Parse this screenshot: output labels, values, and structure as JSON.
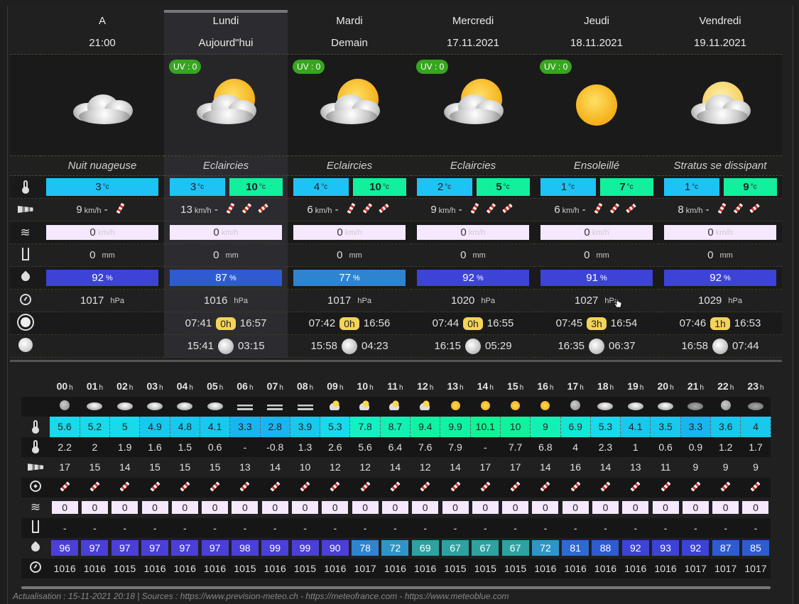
{
  "days": [
    {
      "name": "A",
      "date": "21:00",
      "desc": "Nuit nuageuse",
      "tmin": "3",
      "tmax": null,
      "wind": "9",
      "gust": "0",
      "rain": "0",
      "hum": "92",
      "humColor": "#3c43d6",
      "press": "1017",
      "sunrise": null,
      "daylen": null,
      "sunset": null,
      "moonrise": null,
      "moonset": null,
      "uv": null,
      "icon": "cloud"
    },
    {
      "name": "Lundi",
      "date": "Aujourd\"hui",
      "desc": "Eclaircies",
      "tmin": "3",
      "tmax": "10",
      "wind": "13",
      "gust": "0",
      "rain": "0",
      "hum": "87",
      "humColor": "#2e5bd0",
      "press": "1016",
      "sunrise": "07:41",
      "daylen": "0h",
      "sunset": "16:57",
      "moonrise": "15:41",
      "moonset": "03:15",
      "uv": "UV : 0",
      "icon": "suncloud"
    },
    {
      "name": "Mardi",
      "date": "Demain",
      "desc": "Eclaircies",
      "tmin": "4",
      "tmax": "10",
      "wind": "6",
      "gust": "0",
      "rain": "0",
      "hum": "77",
      "humColor": "#2f84cf",
      "press": "1017",
      "sunrise": "07:42",
      "daylen": "0h",
      "sunset": "16:56",
      "moonrise": "15:58",
      "moonset": "04:23",
      "uv": "UV : 0",
      "icon": "suncloud"
    },
    {
      "name": "Mercredi",
      "date": "17.11.2021",
      "desc": "Eclaircies",
      "tmin": "2",
      "tmax": "5",
      "wind": "9",
      "gust": "0",
      "rain": "0",
      "hum": "92",
      "humColor": "#3c43d6",
      "press": "1020",
      "sunrise": "07:44",
      "daylen": "0h",
      "sunset": "16:55",
      "moonrise": "16:15",
      "moonset": "05:29",
      "uv": "UV : 0",
      "icon": "suncloud"
    },
    {
      "name": "Jeudi",
      "date": "18.11.2021",
      "desc": "Ensoleillé",
      "tmin": "1",
      "tmax": "7",
      "wind": "6",
      "gust": "0",
      "rain": "0",
      "hum": "91",
      "humColor": "#3c43d6",
      "press": "1027",
      "sunrise": "07:45",
      "daylen": "3h",
      "sunset": "16:54",
      "moonrise": "16:35",
      "moonset": "06:37",
      "uv": "UV : 0",
      "icon": "sun"
    },
    {
      "name": "Vendredi",
      "date": "19.11.2021",
      "desc": "Stratus se dissipant",
      "tmin": "1",
      "tmax": "9",
      "wind": "8",
      "gust": "0",
      "rain": "0",
      "hum": "92",
      "humColor": "#3c43d6",
      "press": "1029",
      "sunrise": "07:46",
      "daylen": "1h",
      "sunset": "16:53",
      "moonrise": "16:58",
      "moonset": "07:44",
      "uv": null,
      "icon": "sunbehind"
    }
  ],
  "units": {
    "temp": "°c",
    "wind": "km/h",
    "gust": "km/h",
    "rain": "mm",
    "hum": "%",
    "press": "hPa",
    "wind_sep": "-",
    "hour": "h"
  },
  "hours": [
    "00",
    "01",
    "02",
    "03",
    "04",
    "05",
    "06",
    "07",
    "08",
    "09",
    "10",
    "11",
    "12",
    "13",
    "14",
    "15",
    "16",
    "17",
    "18",
    "19",
    "20",
    "21",
    "22",
    "23"
  ],
  "hourly": {
    "temp": [
      "5.6",
      "5.2",
      "5",
      "4.9",
      "4.8",
      "4.1",
      "3.3",
      "2.8",
      "3.9",
      "5.3",
      "7.8",
      "8.7",
      "9.4",
      "9.9",
      "10.1",
      "10",
      "9",
      "6.9",
      "5.3",
      "4.1",
      "3.5",
      "3.3",
      "3.6",
      "4"
    ],
    "tempColors": [
      "#19d9ea",
      "#19d9ea",
      "#19d9ea",
      "#19c8ec",
      "#19c8ec",
      "#19c8ec",
      "#1ab5ee",
      "#1ab5ee",
      "#19c8ec",
      "#19d9ea",
      "#14f0c4",
      "#14f0b4",
      "#12f2a4",
      "#12f2a4",
      "#12f296",
      "#12f29c",
      "#14f0b4",
      "#14e7d4",
      "#19d9ea",
      "#19c8ec",
      "#19c8ec",
      "#1ab5ee",
      "#19c8ec",
      "#19c8ec"
    ],
    "feels": [
      "2.2",
      "2",
      "1.9",
      "1.6",
      "1.5",
      "0.6",
      "-",
      "-0.8",
      "1.3",
      "2.6",
      "5.6",
      "6.4",
      "7.6",
      "7.9",
      "-",
      "7.7",
      "6.8",
      "4",
      "2.3",
      "1",
      "0.6",
      "0.9",
      "1.2",
      "1.7"
    ],
    "wind": [
      "17",
      "15",
      "14",
      "15",
      "15",
      "15",
      "13",
      "14",
      "10",
      "12",
      "12",
      "14",
      "12",
      "14",
      "17",
      "17",
      "14",
      "16",
      "14",
      "13",
      "11",
      "9",
      "9",
      "9"
    ],
    "gust": [
      "0",
      "0",
      "0",
      "0",
      "0",
      "0",
      "0",
      "0",
      "0",
      "0",
      "0",
      "0",
      "0",
      "0",
      "0",
      "0",
      "0",
      "0",
      "0",
      "0",
      "0",
      "0",
      "0",
      "0"
    ],
    "rain": [
      "-",
      "-",
      "-",
      "-",
      "-",
      "-",
      "-",
      "-",
      "-",
      "-",
      "-",
      "-",
      "-",
      "-",
      "-",
      "-",
      "-",
      "-",
      "-",
      "-",
      "-",
      "-",
      "-",
      "-"
    ],
    "hum": [
      "96",
      "97",
      "97",
      "97",
      "97",
      "97",
      "98",
      "99",
      "99",
      "90",
      "78",
      "72",
      "69",
      "67",
      "67",
      "67",
      "72",
      "81",
      "88",
      "92",
      "93",
      "92",
      "87",
      "85"
    ],
    "humColors": [
      "#4a3fd6",
      "#4a3fd6",
      "#4a3fd6",
      "#4a3fd6",
      "#4a3fd6",
      "#4a3fd6",
      "#4a3fd6",
      "#4a3fd6",
      "#4a3fd6",
      "#4a3fd6",
      "#2f84cf",
      "#2f95c9",
      "#2fa1a1",
      "#2fa1a1",
      "#2fa1a1",
      "#2fa1a1",
      "#2f95c9",
      "#2e6bd0",
      "#2e5bd0",
      "#3c43d6",
      "#3c43d6",
      "#3c43d6",
      "#2e5bd0",
      "#2e5bd0"
    ],
    "press": [
      "1016",
      "1016",
      "1015",
      "1016",
      "1016",
      "1016",
      "1015",
      "1016",
      "1015",
      "1016",
      "1017",
      "1016",
      "1016",
      "1015",
      "1015",
      "1015",
      "1016",
      "1016",
      "1016",
      "1016",
      "1016",
      "1017",
      "1017",
      "1017"
    ],
    "icons": [
      "moon-cloud",
      "cloud",
      "cloud",
      "cloud",
      "cloud",
      "cloud",
      "fog",
      "fog",
      "fog",
      "sun-cloud",
      "sun-cloud",
      "sun-cloud",
      "sun-cloud",
      "sun",
      "sun",
      "sun",
      "sun",
      "moon-cloud",
      "cloud",
      "cloud",
      "cloud",
      "cloud-dark",
      "moon-cloud",
      "cloud-dark"
    ]
  },
  "footer": "Actualisation : 15-11-2021 20:18 | Sources : https://www.prevision-meteo.ch - https://meteofrance.com - https://www.meteoblue.com"
}
